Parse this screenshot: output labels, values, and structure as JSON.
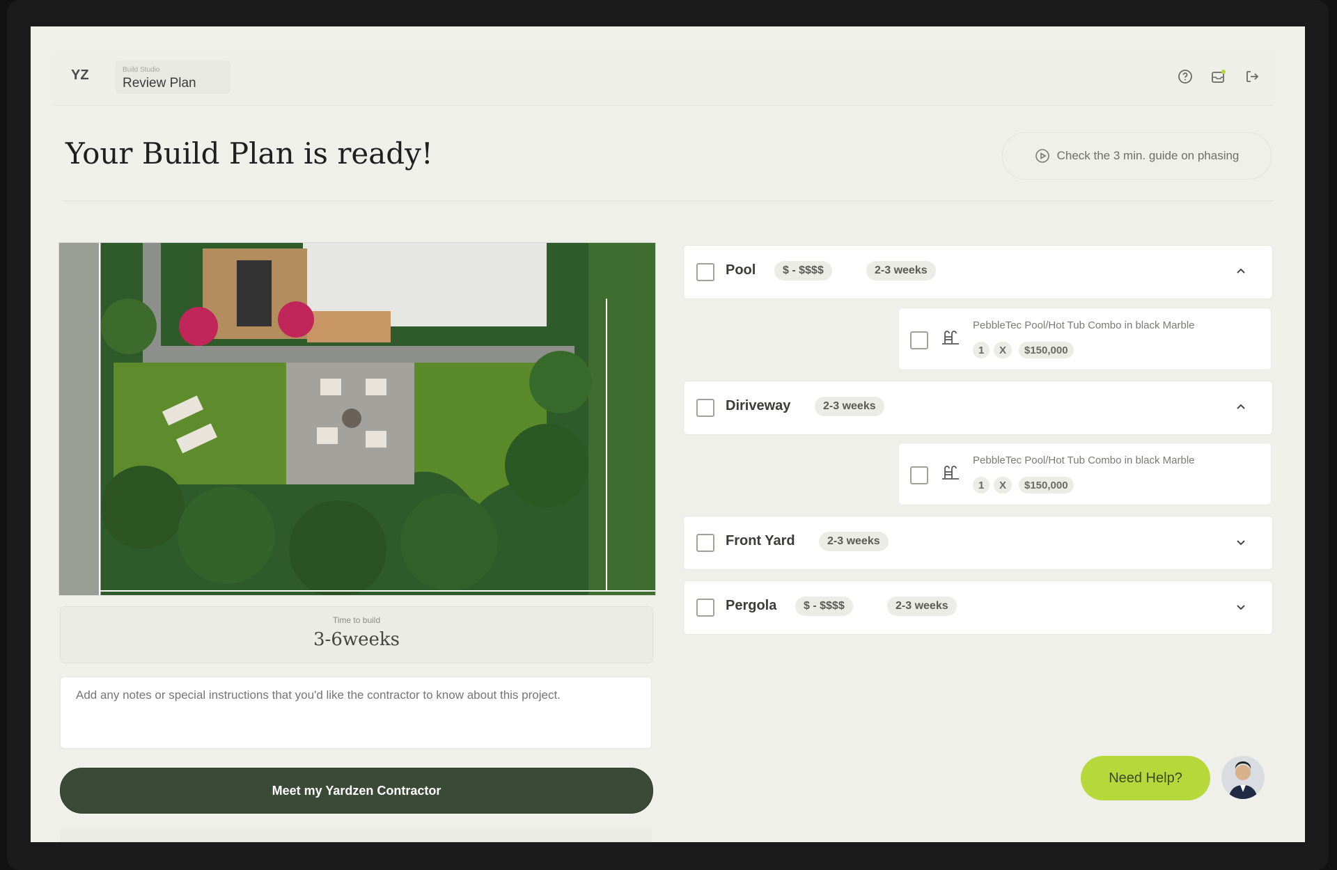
{
  "header": {
    "logo": "YZ",
    "breadcrumb_small": "Build Studio",
    "breadcrumb_title": "Review Plan",
    "icons": [
      "help-icon",
      "notification-icon",
      "logout-icon"
    ]
  },
  "main": {
    "title": "Your Build Plan is ready!",
    "guide_link": "Check the 3 min. guide on phasing",
    "time_to_build_label": "Time to build",
    "time_to_build_value": "3-6weeks",
    "notes_placeholder": "Add any notes or special instructions that you'd like the contractor to know about this project.",
    "cta_label": "Meet my Yardzen Contractor"
  },
  "phases": [
    {
      "name": "Pool",
      "price": "$ - $$$$",
      "duration": "2-3 weeks",
      "expanded": true,
      "item": {
        "title": "PebbleTec Pool/Hot Tub Combo in black Marble",
        "qty": "1",
        "times": "X",
        "price": "$150,000"
      }
    },
    {
      "name": "Diriveway",
      "duration": "2-3 weeks",
      "expanded": true,
      "item": {
        "title": "PebbleTec Pool/Hot Tub Combo in black Marble",
        "qty": "1",
        "times": "X",
        "price": "$150,000"
      }
    },
    {
      "name": "Front Yard",
      "duration": "2-3 weeks",
      "expanded": false
    },
    {
      "name": "Pergola",
      "price": "$ - $$$$",
      "duration": "2-3 weeks",
      "expanded": false
    }
  ],
  "help": {
    "label": "Need Help?"
  },
  "colors": {
    "accent_dark": "#3b4a36",
    "help_green": "#b7d83a",
    "background": "#f0f0ea"
  }
}
